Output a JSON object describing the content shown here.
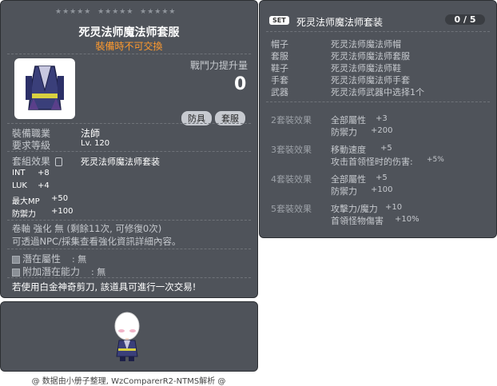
{
  "item_id": "01052785",
  "item": {
    "name": "死灵法师魔法师套服",
    "trade_note": "裝備時不可交換",
    "power_label": "戰鬥力提升量",
    "power_value": "0",
    "type_tags": [
      "防具",
      "套服"
    ],
    "job_label": "裝備職業",
    "job_value": "法師",
    "level_label": "要求等級",
    "level_value": "Lv. 120",
    "set_label": "套組效果",
    "set_value": "死灵法师魔法师套装",
    "stats": [
      {
        "name": "INT",
        "value": "+8"
      },
      {
        "name": "LUK",
        "value": "+4"
      },
      {
        "name": "最大MP",
        "value": "+50"
      },
      {
        "name": "防禦力",
        "value": "+100"
      }
    ],
    "enhance_line": "卷軸 強化 無 (剩餘11次, 可修復0次)",
    "enhance_note": "可透過NPC/採集查看強化資訊詳細內容。",
    "potential_label": "潛在屬性",
    "potential_value": ": 無",
    "bonus_potential_label": "附加潛在能力",
    "bonus_potential_value": ": 無",
    "scissors_note": "若使用白金神奇剪刀, 該道具可進行一次交易!"
  },
  "set": {
    "badge": "SET",
    "title": "死灵法师魔法师套装",
    "count": "0 / 5",
    "parts": [
      {
        "slot": "帽子",
        "item": "死灵法师魔法师帽"
      },
      {
        "slot": "套服",
        "item": "死灵法师魔法师套服"
      },
      {
        "slot": "鞋子",
        "item": "死灵法师魔法师鞋"
      },
      {
        "slot": "手套",
        "item": "死灵法师魔法师手套"
      },
      {
        "slot": "武器",
        "item": "死灵法师武器中选择1个"
      }
    ],
    "effects": [
      {
        "label": "2套裝效果",
        "lines": [
          [
            "全部屬性",
            "+3"
          ],
          [
            "防禦力",
            "+200"
          ]
        ]
      },
      {
        "label": "3套裝效果",
        "lines": [
          [
            "移動速度",
            "+5"
          ],
          [
            "攻击首领怪时的伤害:",
            "+5%"
          ]
        ]
      },
      {
        "label": "4套裝效果",
        "lines": [
          [
            "全部屬性",
            "+5"
          ],
          [
            "防禦力",
            "+100"
          ]
        ]
      },
      {
        "label": "5套裝效果",
        "lines": [
          [
            "攻擊力/魔力",
            "+10"
          ],
          [
            "首領怪物傷害",
            "+10%"
          ]
        ]
      }
    ]
  },
  "footer": "@ 数据由小册子整理, WzComparerR2-NTMS解析 @",
  "colors": {
    "panel": "#4f535a",
    "orange": "#ff9a2e",
    "text": "#ffffff"
  },
  "icons": [
    "item-robe-icon",
    "checkbox-icon",
    "lock-icon",
    "character-sprite"
  ]
}
